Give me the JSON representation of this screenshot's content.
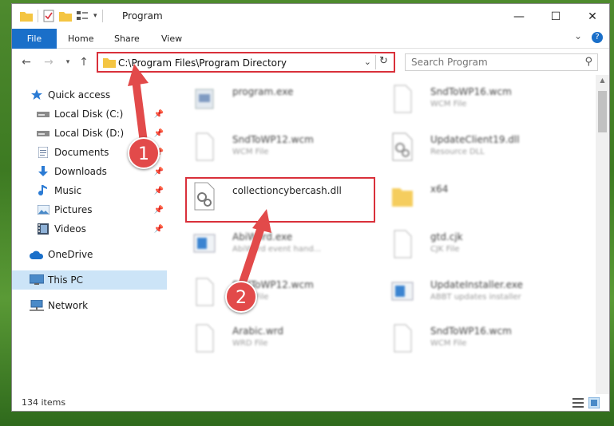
{
  "window": {
    "title": "Program",
    "controls": {
      "minimize": "—",
      "maximize": "☐",
      "close": "✕"
    }
  },
  "ribbon": {
    "tabs": [
      "File",
      "Home",
      "Share",
      "View"
    ],
    "help_icon": "?",
    "expand_icon": "⌄"
  },
  "address_bar": {
    "path": "C:\\Program Files\\Program Directory"
  },
  "search": {
    "placeholder": "Search Program"
  },
  "sidebar": {
    "items": [
      {
        "label": "Quick access",
        "icon": "star-icon"
      },
      {
        "label": "Local Disk (C:)",
        "icon": "drive-icon",
        "pinned": true
      },
      {
        "label": "Local Disk (D:)",
        "icon": "drive-icon",
        "pinned": true
      },
      {
        "label": "Documents",
        "icon": "documents-icon",
        "pinned": true
      },
      {
        "label": "Downloads",
        "icon": "downloads-icon",
        "pinned": true
      },
      {
        "label": "Music",
        "icon": "music-icon",
        "pinned": true
      },
      {
        "label": "Pictures",
        "icon": "pictures-icon",
        "pinned": true
      },
      {
        "label": "Videos",
        "icon": "videos-icon",
        "pinned": true
      },
      {
        "label": "OneDrive",
        "icon": "cloud-icon"
      },
      {
        "label": "This PC",
        "icon": "computer-icon",
        "selected": true
      },
      {
        "label": "Network",
        "icon": "network-icon"
      }
    ]
  },
  "files": [
    {
      "name": "program.exe",
      "type": "",
      "blurred": true
    },
    {
      "name": "SndToWP16.wcm",
      "type": "WCM File",
      "blurred": true
    },
    {
      "name": "SndToWP12.wcm",
      "type": "WCM File",
      "blurred": true
    },
    {
      "name": "UpdateClient19.dll",
      "type": "Resource DLL",
      "blurred": true
    },
    {
      "name": "collectioncybercash.dll",
      "type": "",
      "blurred": false
    },
    {
      "name": "x64",
      "type": "",
      "blurred": true
    },
    {
      "name": "AbiWord.exe",
      "type": "AbiWord event hand...",
      "blurred": true
    },
    {
      "name": "gtd.cjk",
      "type": "CJK File",
      "blurred": true
    },
    {
      "name": "SndToWP12.wcm",
      "type": "WCM File",
      "blurred": true
    },
    {
      "name": "UpdateInstaller.exe",
      "type": "ABBT updates installer",
      "blurred": true
    },
    {
      "name": "Arabic.wrd",
      "type": "WRD File",
      "blurred": true
    },
    {
      "name": "SndToWP16.wcm",
      "type": "WCM File",
      "blurred": true
    }
  ],
  "status": {
    "item_count": "134 items"
  },
  "annotations": {
    "badge_1": "1",
    "badge_2": "2",
    "accent_color": "#d9303a"
  }
}
